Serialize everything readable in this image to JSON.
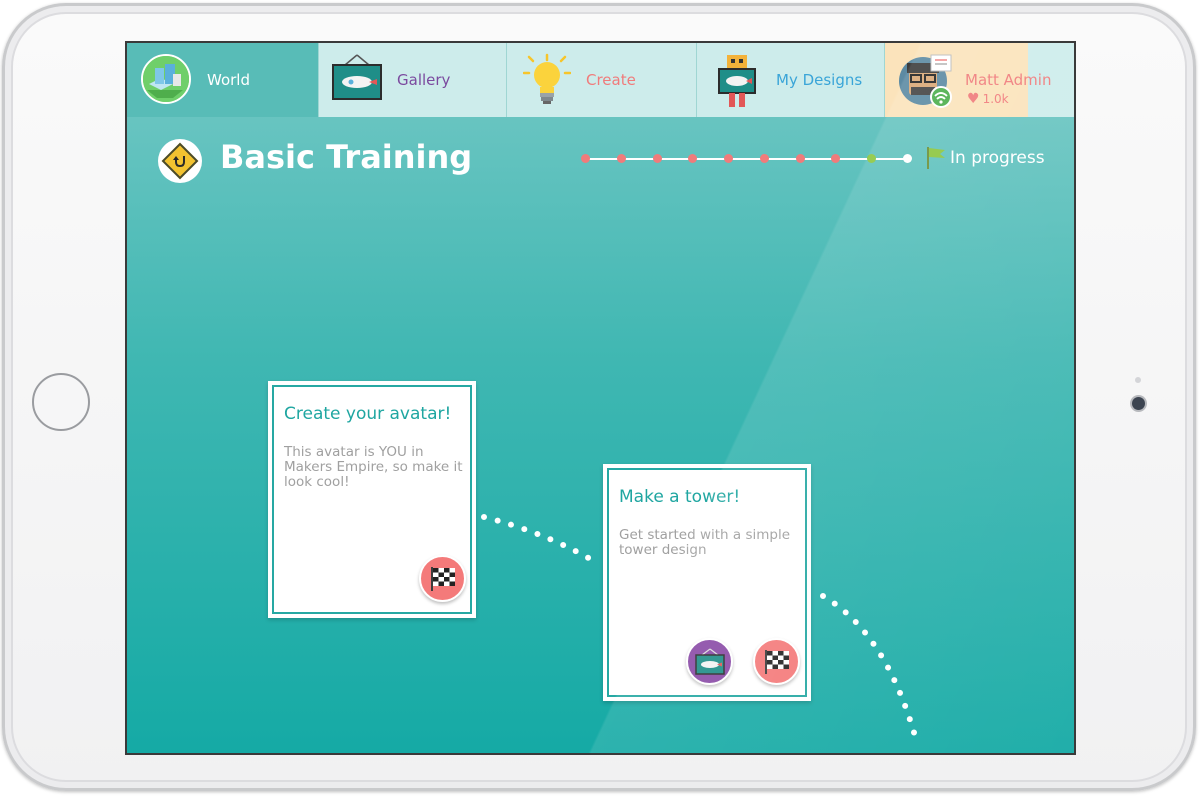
{
  "nav": {
    "tabs": [
      {
        "label": "World",
        "icon": "world-icon"
      },
      {
        "label": "Gallery",
        "icon": "gallery-icon"
      },
      {
        "label": "Create",
        "icon": "lightbulb-icon"
      },
      {
        "label": "My Designs",
        "icon": "robot-icon"
      }
    ],
    "profile": {
      "name": "Matt Admin",
      "likes": "1.0k"
    }
  },
  "header": {
    "title": "Basic Training",
    "status": "In progress",
    "progress": {
      "total_steps": 10,
      "completed_steps": 8,
      "current_step": 9
    }
  },
  "cards": [
    {
      "title": "Create your avatar!",
      "description": "This avatar is YOU in Makers Empire, so make it look cool!"
    },
    {
      "title": "Make a tower!",
      "description": "Get started with a simple tower design"
    }
  ],
  "colors": {
    "accent": "#1fa6a1",
    "step_done": "#f07b7b",
    "step_current": "#8cc63f",
    "step_pending": "#ffffff",
    "finish_badge": "#f47a7a",
    "gallery_badge": "#8a4ba7"
  }
}
